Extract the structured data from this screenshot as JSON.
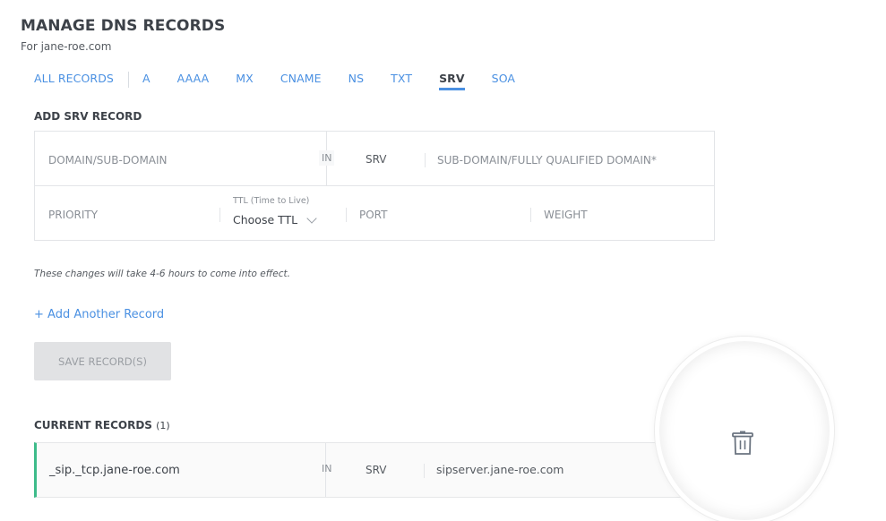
{
  "header": {
    "title": "MANAGE DNS RECORDS",
    "subtitle": "For jane-roe.com"
  },
  "tabs": [
    {
      "label": "ALL RECORDS",
      "active": false
    },
    {
      "label": "A",
      "active": false
    },
    {
      "label": "AAAA",
      "active": false
    },
    {
      "label": "MX",
      "active": false
    },
    {
      "label": "CNAME",
      "active": false
    },
    {
      "label": "NS",
      "active": false
    },
    {
      "label": "TXT",
      "active": false
    },
    {
      "label": "SRV",
      "active": true
    },
    {
      "label": "SOA",
      "active": false
    }
  ],
  "add_form": {
    "title": "ADD SRV RECORD",
    "domain_placeholder": "DOMAIN/SUB-DOMAIN",
    "class_label": "IN",
    "type_label": "SRV",
    "target_placeholder": "SUB-DOMAIN/FULLY QUALIFIED DOMAIN*",
    "priority_placeholder": "PRIORITY",
    "ttl_label": "TTL (Time to Live)",
    "ttl_value": "Choose TTL",
    "port_placeholder": "PORT",
    "weight_placeholder": "WEIGHT"
  },
  "note": "These changes will take 4-6 hours to come into effect.",
  "add_another_label": "+ Add Another Record",
  "save_label": "SAVE RECORD(S)",
  "current": {
    "title": "CURRENT RECORDS",
    "count": "(1)",
    "records": [
      {
        "name": "_sip._tcp.jane-roe.com",
        "class": "IN",
        "type": "SRV",
        "target": "sipserver.jane-roe.com"
      }
    ]
  },
  "colors": {
    "accent": "#4a90e2",
    "record_border": "#3dbb8a",
    "icon": "#6b7480"
  }
}
